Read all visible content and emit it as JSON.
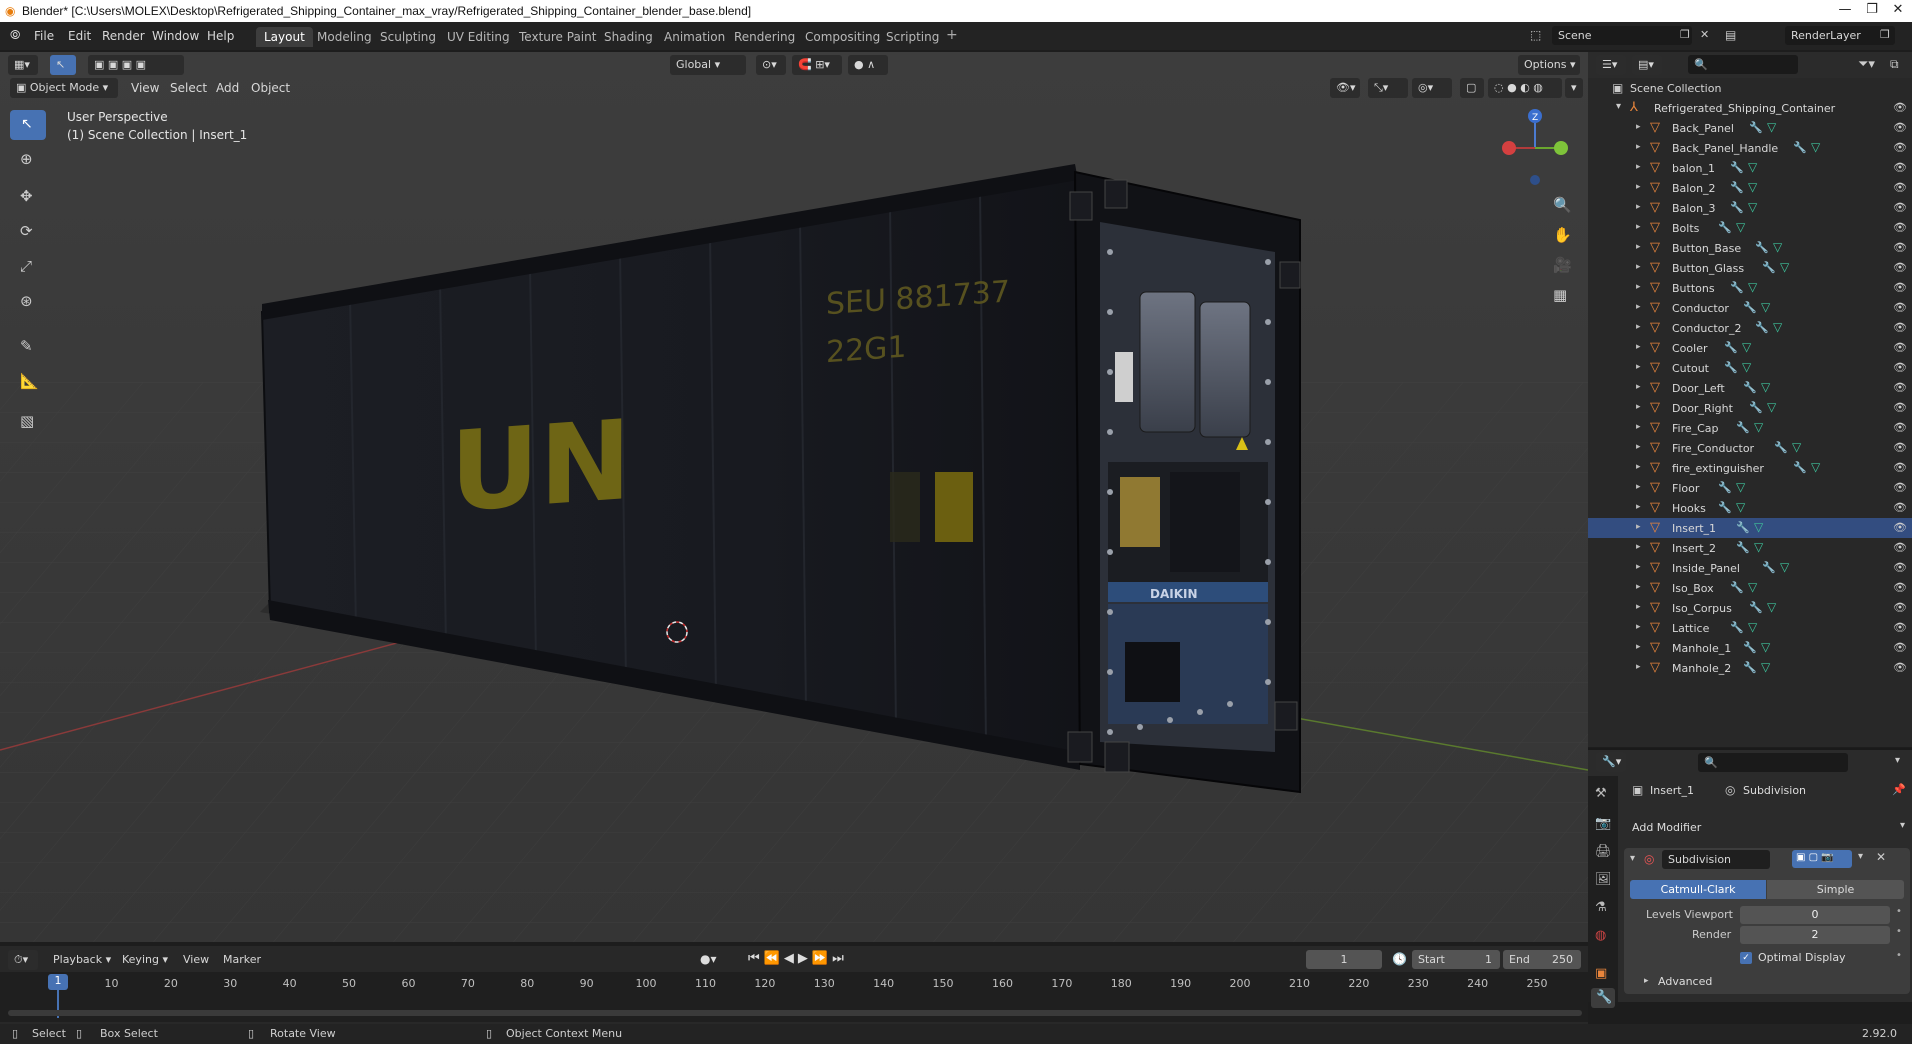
{
  "window": {
    "title": "Blender* [C:\\Users\\MOLEX\\Desktop\\Refrigerated_Shipping_Container_max_vray/Refrigerated_Shipping_Container_blender_base.blend]"
  },
  "menu": {
    "items": [
      "File",
      "Edit",
      "Render",
      "Window",
      "Help"
    ]
  },
  "workspaces": [
    "Layout",
    "Modeling",
    "Sculpting",
    "UV Editing",
    "Texture Paint",
    "Shading",
    "Animation",
    "Rendering",
    "Compositing",
    "Scripting"
  ],
  "active_workspace": "Layout",
  "scene": {
    "name": "Scene",
    "render_layer": "RenderLayer"
  },
  "viewport_header": {
    "mode": "Object Mode",
    "menus": [
      "View",
      "Select",
      "Add",
      "Object"
    ],
    "orientation": "Global",
    "options": "Options"
  },
  "viewport": {
    "perspective": "User Perspective",
    "collection_info": "(1) Scene Collection | Insert_1",
    "container_text_un": "UN",
    "container_text_code1": "SEU 881737",
    "container_text_code2": "22G1",
    "brand_label": "DAIKIN"
  },
  "outliner": {
    "root": "Scene Collection",
    "collection": "Refrigerated_Shipping_Container",
    "selected": "Insert_1",
    "items": [
      "Back_Panel",
      "Back_Panel_Handle",
      "balon_1",
      "Balon_2",
      "Balon_3",
      "Bolts",
      "Button_Base",
      "Button_Glass",
      "Buttons",
      "Conductor",
      "Conductor_2",
      "Cooler",
      "Cutout",
      "Door_Left",
      "Door_Right",
      "Fire_Cap",
      "Fire_Conductor",
      "fire_extinguisher",
      "Floor",
      "Hooks",
      "Insert_1",
      "Insert_2",
      "Inside_Panel",
      "Iso_Box",
      "Iso_Corpus",
      "Lattice",
      "Manhole_1",
      "Manhole_2"
    ]
  },
  "properties": {
    "object": "Insert_1",
    "modifier_tab": "Subdivision",
    "add_modifier": "Add Modifier",
    "modifier_name": "Subdivision",
    "type_catmull": "Catmull-Clark",
    "type_simple": "Simple",
    "levels_viewport_label": "Levels Viewport",
    "levels_viewport_value": "0",
    "render_label": "Render",
    "render_value": "2",
    "optimal_display": "Optimal Display",
    "advanced": "Advanced"
  },
  "timeline": {
    "menus": [
      "Playback",
      "Keying",
      "View",
      "Marker"
    ],
    "current_frame": "1",
    "start_label": "Start",
    "start_value": "1",
    "end_label": "End",
    "end_value": "250",
    "ticks": [
      "1",
      "10",
      "20",
      "30",
      "40",
      "50",
      "60",
      "70",
      "80",
      "90",
      "100",
      "110",
      "120",
      "130",
      "140",
      "150",
      "160",
      "170",
      "180",
      "190",
      "200",
      "210",
      "220",
      "230",
      "240",
      "250"
    ]
  },
  "statusbar": {
    "select": "Select",
    "box_select": "Box Select",
    "rotate_view": "Rotate View",
    "context_menu": "Object Context Menu",
    "version": "2.92.0"
  },
  "colors": {
    "accent": "#4772b3",
    "selection": "#334d80",
    "object_orange": "#e8853c",
    "mesh_green": "#3ec29b",
    "modifier_blue": "#6a8bc9"
  }
}
